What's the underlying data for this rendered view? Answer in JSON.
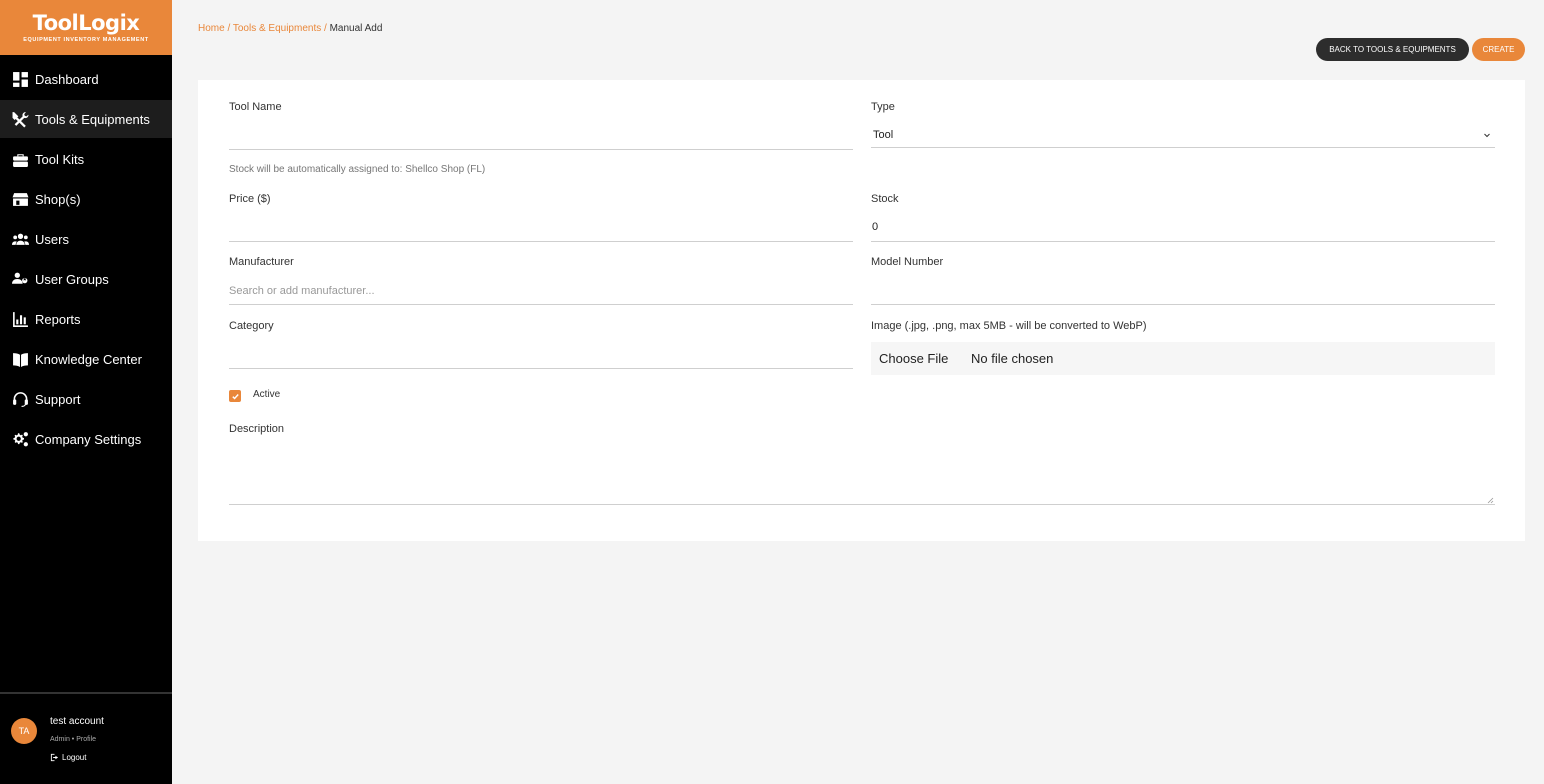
{
  "brand": {
    "title": "ToolLogix",
    "subtitle": "EQUIPMENT INVENTORY MANAGEMENT",
    "accent": "#e9873a"
  },
  "sidebar": {
    "items": [
      {
        "label": "Dashboard",
        "icon": "dashboard-icon"
      },
      {
        "label": "Tools & Equipments",
        "icon": "tools-icon",
        "active": true
      },
      {
        "label": "Tool Kits",
        "icon": "toolbox-icon"
      },
      {
        "label": "Shop(s)",
        "icon": "shop-icon"
      },
      {
        "label": "Users",
        "icon": "users-icon"
      },
      {
        "label": "User Groups",
        "icon": "user-groups-icon"
      },
      {
        "label": "Reports",
        "icon": "chart-icon"
      },
      {
        "label": "Knowledge Center",
        "icon": "book-icon"
      },
      {
        "label": "Support",
        "icon": "headset-icon"
      },
      {
        "label": "Company Settings",
        "icon": "gears-icon"
      }
    ]
  },
  "user": {
    "initials": "TA",
    "name": "test account",
    "role": "Admin",
    "separator": "•",
    "profile_link": "Profile",
    "logout_label": "Logout"
  },
  "breadcrumb": {
    "home": "Home",
    "sep1": " / ",
    "section": "Tools & Equipments",
    "sep2": " / ",
    "current": "Manual Add"
  },
  "actions": {
    "back_label": "Back to Tools & Equipments",
    "create_label": "Create"
  },
  "form": {
    "tool_name": {
      "label": "Tool Name",
      "value": ""
    },
    "type": {
      "label": "Type",
      "value": "Tool"
    },
    "stock_hint": "Stock will be automatically assigned to: Shellco Shop (FL)",
    "price": {
      "label": "Price ($)",
      "value": ""
    },
    "stock": {
      "label": "Stock",
      "value": "0"
    },
    "manufacturer": {
      "label": "Manufacturer",
      "placeholder": "Search or add manufacturer..."
    },
    "model_number": {
      "label": "Model Number",
      "value": ""
    },
    "category": {
      "label": "Category",
      "value": ""
    },
    "image": {
      "label": "Image (.jpg, .png, max 5MB - will be converted to WebP)",
      "button_label": "Choose File",
      "status": "No file chosen"
    },
    "active": {
      "label": "Active",
      "checked": true
    },
    "description": {
      "label": "Description",
      "value": ""
    }
  }
}
